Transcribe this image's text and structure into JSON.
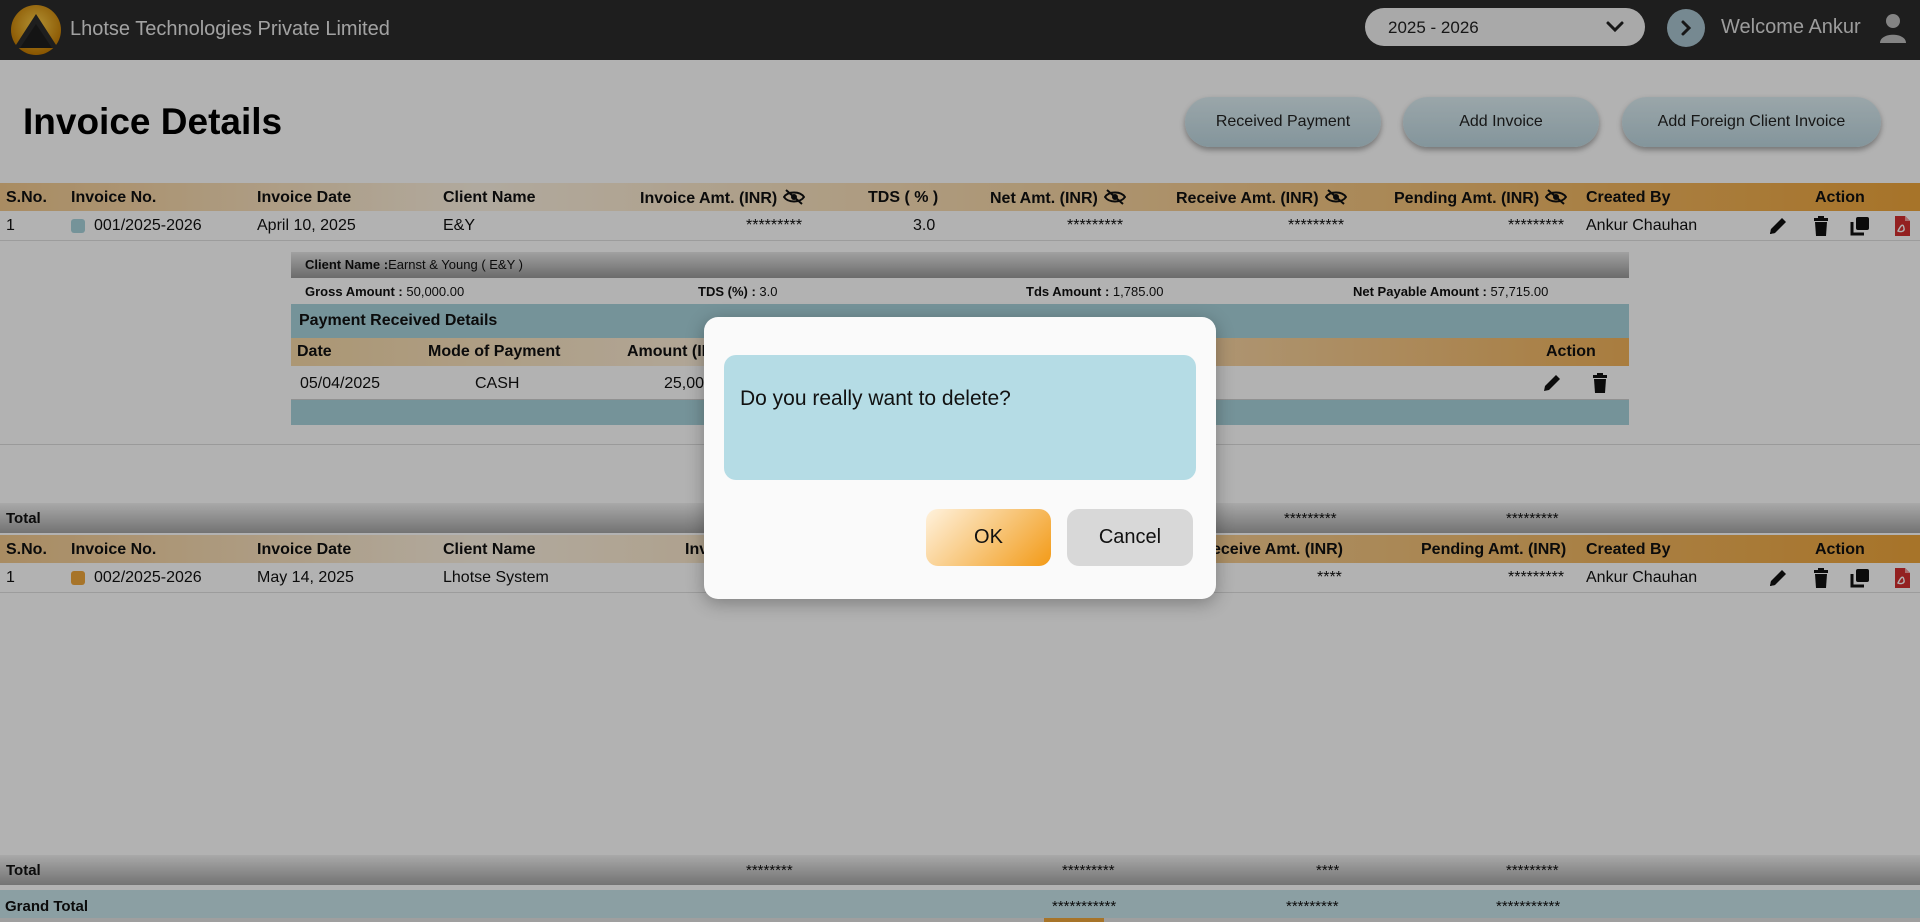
{
  "topbar": {
    "company": "Lhotse Technologies Private Limited",
    "financial_year": "2025 - 2026",
    "welcome": "Welcome Ankur"
  },
  "page": {
    "title": "Invoice Details",
    "buttons": {
      "received_payment": "Received Payment",
      "add_invoice": "Add Invoice",
      "add_foreign": "Add Foreign Client Invoice"
    }
  },
  "columns": {
    "sno": "S.No.",
    "invoice_no": "Invoice No.",
    "invoice_date": "Invoice Date",
    "client_name": "Client Name",
    "invoice_amt": "Invoice Amt. (INR)",
    "tds": "TDS ( % )",
    "net_amt": "Net Amt. (INR)",
    "receive_amt": "Receive Amt. (INR)",
    "pending_amt": "Pending Amt. (INR)",
    "created_by": "Created By",
    "action": "Action"
  },
  "section2_columns": {
    "invoice_partial": "Inv",
    "receive_partial": "eceive Amt. (INR)"
  },
  "invoices": [
    {
      "sno": "1",
      "invoice_no": "001/2025-2026",
      "invoice_date": "April 10, 2025",
      "client_name": "E&Y",
      "invoice_amt": "*********",
      "tds": "3.0",
      "net_amt": "*********",
      "receive_amt": "*********",
      "pending_amt": "*********",
      "created_by": "Ankur Chauhan",
      "color": "#a8d3dc"
    },
    {
      "sno": "1",
      "invoice_no": "002/2025-2026",
      "invoice_date": "May 14, 2025",
      "client_name": "Lhotse System",
      "receive_amt": "****",
      "pending_amt": "*********",
      "created_by": "Ankur Chauhan",
      "color": "#f0a63b"
    }
  ],
  "detail": {
    "client_label": "Client Name :",
    "client_value": "Earnst & Young ( E&Y )",
    "gross_label": "Gross Amount :",
    "gross_value": "50,000.00",
    "tds_label": "TDS (%) :",
    "tds_value": "3.0",
    "tds_amt_label": "Tds Amount :",
    "tds_amt_value": "1,785.00",
    "net_label": "Net Payable Amount :",
    "net_value": "57,715.00",
    "payment_header": "Payment Received Details",
    "payment_columns": {
      "date": "Date",
      "mode": "Mode of Payment",
      "amount_partial": "Amount (IN",
      "action": "Action"
    },
    "payment_row": {
      "date": "05/04/2025",
      "mode": "CASH",
      "amount_partial": "25,00"
    }
  },
  "totals": {
    "label": "Total",
    "section1": {
      "receive": "*********",
      "pending": "*********"
    },
    "section2": {
      "invoice": "********",
      "net": "*********",
      "receive": "****",
      "pending": "*********"
    }
  },
  "grand_total": {
    "label": "Grand Total",
    "net": "***********",
    "receive": "*********",
    "pending": "***********"
  },
  "dialog": {
    "message": "Do you really want to delete?",
    "ok": "OK",
    "cancel": "Cancel"
  },
  "icons": {
    "edit": "pencil-icon",
    "delete": "trash-icon",
    "copy": "copy-icon",
    "pdf": "pdf-icon",
    "hidden": "eye-slash-icon"
  },
  "colors": {
    "topbar": "#2b2b2b",
    "accent_orange": "#f0a63b",
    "accent_blue": "#a8d3dc",
    "pdf_red": "#d32f2f"
  }
}
